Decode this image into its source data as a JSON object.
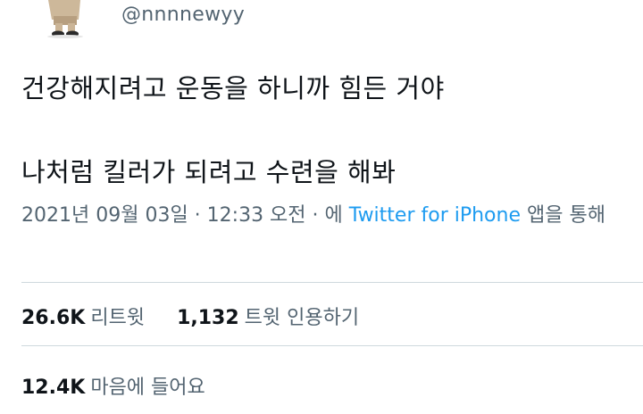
{
  "author": {
    "handle": "@nnnnewyy",
    "avatar_icon": "profile-figure-icon"
  },
  "tweet": {
    "lines": [
      "건강해지려고 운동을 하니까 힘든 거야",
      "나처럼 킬러가 되려고 수련을 해봐"
    ],
    "timestamp": "2021년 09월 03일 · 12:33 오전 · 에",
    "via_label": "Twitter for iPhone",
    "via_suffix": "앱을 통해"
  },
  "stats": {
    "retweets_count": "26.6K",
    "retweets_label": "리트윗",
    "quotes_count": "1,132",
    "quotes_label": "트윗 인용하기",
    "likes_count": "12.4K",
    "likes_label": "마음에 들어요"
  },
  "colors": {
    "text": "#0f1419",
    "secondary": "#536471",
    "link": "#1d9bf0",
    "divider": "#cfd9de"
  }
}
